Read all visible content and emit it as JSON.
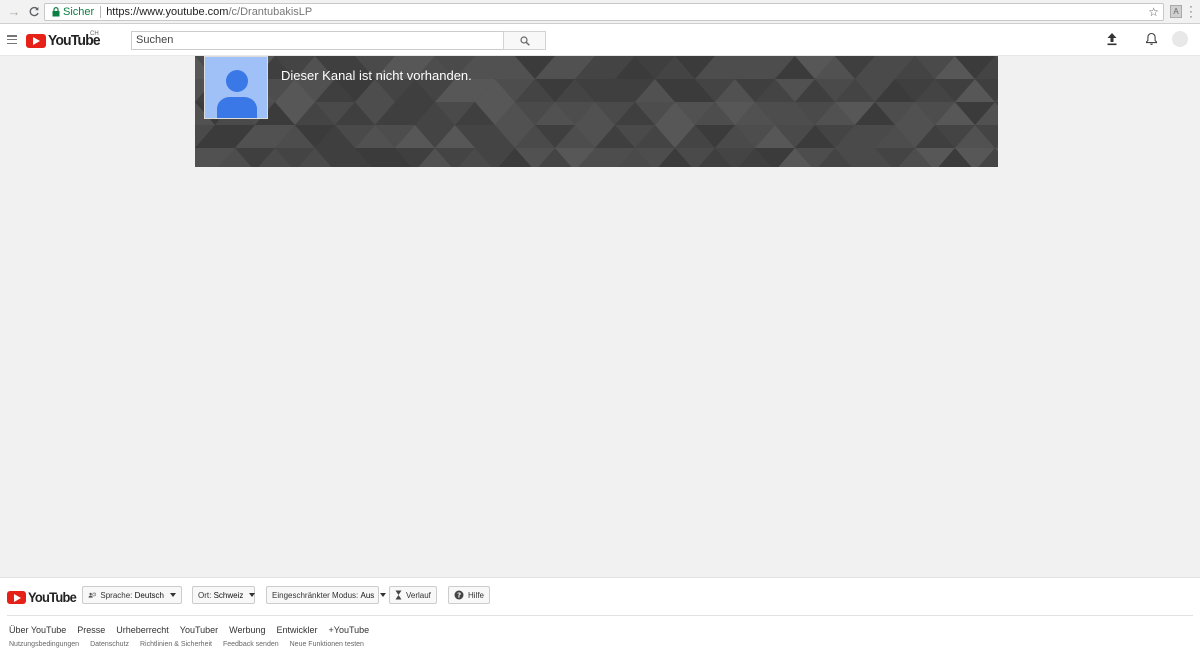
{
  "browser": {
    "secure_label": "Sicher",
    "url_main": "https://www.youtube.com",
    "url_path": "/c/DrantubakisLP"
  },
  "header": {
    "logo_text": "YouTube",
    "region": "CH",
    "search_placeholder": "Suchen"
  },
  "channel": {
    "message": "Dieser Kanal ist nicht vorhanden."
  },
  "footer": {
    "logo_text": "YouTube",
    "language_label": "Sprache:",
    "language_value": "Deutsch",
    "location_label": "Ort:",
    "location_value": "Schweiz",
    "restricted_label": "Eingeschränkter Modus:",
    "restricted_value": "Aus",
    "history_label": "Verlauf",
    "help_label": "Hilfe",
    "links_main": [
      "Über YouTube",
      "Presse",
      "Urheberrecht",
      "YouTuber",
      "Werbung",
      "Entwickler",
      "+YouTube"
    ],
    "links_sub": [
      "Nutzungsbedingungen",
      "Datenschutz",
      "Richtlinien & Sicherheit",
      "Feedback senden",
      "Neue Funktionen testen"
    ]
  },
  "colors": {
    "brand_red": "#e62117",
    "secure_green": "#0b8043",
    "avatar_blue": "#9fc1f7",
    "avatar_figure": "#3b78e7",
    "banner_bg": "#474747"
  }
}
